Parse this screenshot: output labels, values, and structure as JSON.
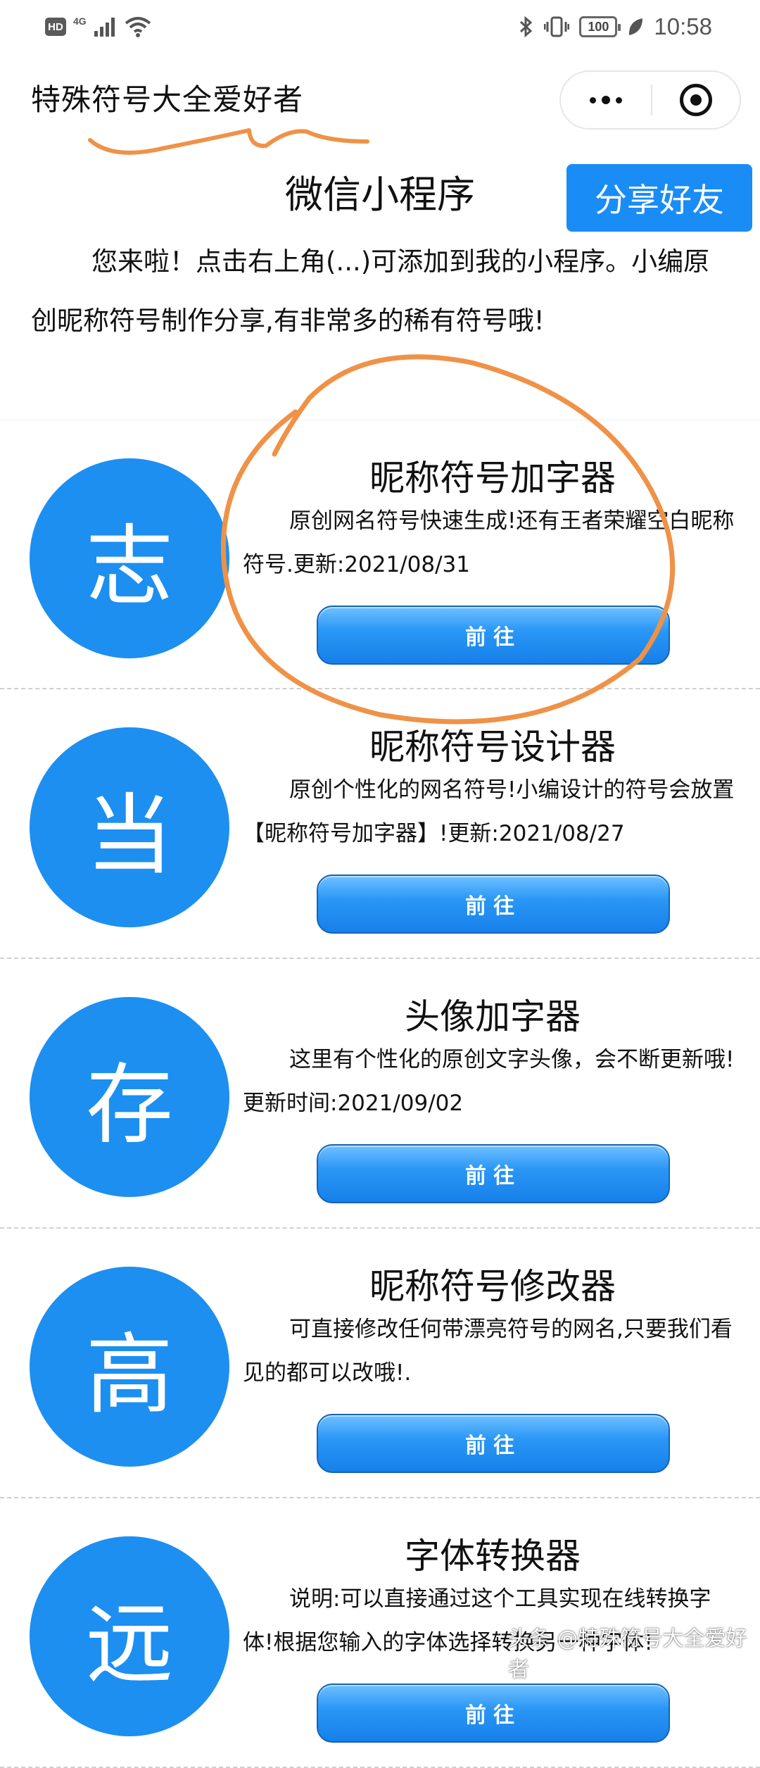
{
  "status_bar": {
    "hd_badge": "HD",
    "network": "4G",
    "battery": "100",
    "time": "10:58"
  },
  "nav": {
    "title": "特殊符号大全爱好者"
  },
  "intro": {
    "mini_program_label": "微信小程序",
    "share_label": "分享好友",
    "text": "您来啦！点击右上角(...)可添加到我的小程序。小编原创昵称符号制作分享,有非常多的稀有符号哦!"
  },
  "tools": [
    {
      "avatar": "志",
      "title": "昵称符号加字器",
      "desc": "原创网名符号快速生成!还有王者荣耀空白昵称符号.更新:2021/08/31",
      "button": "前往"
    },
    {
      "avatar": "当",
      "title": "昵称符号设计器",
      "desc": "原创个性化的网名符号!小编设计的符号会放置【昵称符号加字器】!更新:2021/08/27",
      "button": "前往"
    },
    {
      "avatar": "存",
      "title": "头像加字器",
      "desc": "这里有个性化的原创文字头像，会不断更新哦!更新时间:2021/09/02",
      "button": "前往"
    },
    {
      "avatar": "高",
      "title": "昵称符号修改器",
      "desc": "可直接修改任何带漂亮符号的网名,只要我们看见的都可以改哦!.",
      "button": "前往"
    },
    {
      "avatar": "远",
      "title": "字体转换器",
      "desc": "说明:可以直接通过这个工具实现在线转换字体!根据您输入的字体选择转换另一种字体!",
      "button": "前往"
    }
  ],
  "watermark": "头条 @特殊符号大全爱好者",
  "colors": {
    "accent_blue": "#1a8cf6",
    "annotation_orange": "#ef9247"
  }
}
